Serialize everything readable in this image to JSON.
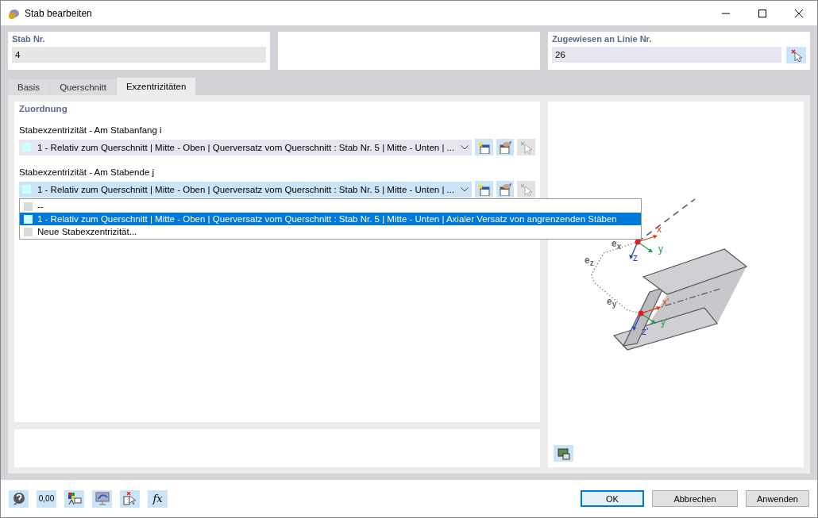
{
  "window": {
    "title": "Stab bearbeiten"
  },
  "header": {
    "member_no": {
      "label": "Stab Nr.",
      "value": "4"
    },
    "assigned_line": {
      "label": "Zugewiesen an Linie Nr.",
      "value": "26",
      "pick_disabled": false
    }
  },
  "tabs": [
    {
      "label": "Basis",
      "selected": false
    },
    {
      "label": "Querschnitt",
      "selected": false
    },
    {
      "label": "Exzentrizitäten",
      "selected": true
    }
  ],
  "section": {
    "title": "Zuordnung"
  },
  "fields": [
    {
      "label": "Stabexzentrizität - Am Stabanfang i",
      "value": "1 - Relativ zum Querschnitt | Mitte - Oben | Querversatz vom Querschnitt : Stab Nr. 5 | Mitte - Unten | ...",
      "color": "#ccffff",
      "open": false,
      "tools": [
        {
          "kind": "new",
          "disabled": false
        },
        {
          "kind": "edit",
          "disabled": false
        },
        {
          "kind": "pick",
          "disabled": true
        }
      ]
    },
    {
      "label": "Stabexzentrizität - Am Stabende j",
      "value": "1 - Relativ zum Querschnitt | Mitte - Oben | Querversatz vom Querschnitt : Stab Nr. 5 | Mitte - Unten | ...",
      "color": "#ccffff",
      "open": true,
      "tools": [
        {
          "kind": "new",
          "disabled": false
        },
        {
          "kind": "edit",
          "disabled": false
        },
        {
          "kind": "pick",
          "disabled": true
        }
      ]
    }
  ],
  "dropdown": {
    "options": [
      {
        "text": "--",
        "selected": false,
        "color": "#d9d9d9"
      },
      {
        "text": "1 - Relativ zum Querschnitt | Mitte - Oben | Querversatz vom Querschnitt : Stab Nr. 5 | Mitte - Unten | Axialer Versatz von angrenzenden Stäben",
        "selected": true,
        "color": "#ccffff"
      },
      {
        "text": "Neue Stabexzentrizität...",
        "selected": false,
        "color": "#d9d9d9"
      }
    ]
  },
  "diagram_labels": [
    {
      "text": "x",
      "kind": "x"
    },
    {
      "text": "y",
      "kind": "y"
    },
    {
      "text": "z",
      "kind": "z"
    },
    {
      "text": "e$_{x}$",
      "kind": "e"
    },
    {
      "text": "e$_{z}$",
      "kind": "e"
    },
    {
      "text": "e$_{y}$",
      "kind": "e"
    },
    {
      "text": "x'",
      "kind": "x"
    },
    {
      "text": "y'",
      "kind": "y"
    },
    {
      "text": "z'",
      "kind": "z"
    }
  ],
  "tools": [
    {
      "kind": "help"
    },
    {
      "kind": "units",
      "text": "0,00"
    },
    {
      "kind": "colors"
    },
    {
      "kind": "view"
    },
    {
      "kind": "select"
    },
    {
      "kind": "formula",
      "text": "fx"
    }
  ],
  "buttons": [
    {
      "label": "OK",
      "default": true
    },
    {
      "label": "Abbrechen",
      "default": false
    },
    {
      "label": "Anwenden",
      "default": false
    }
  ]
}
